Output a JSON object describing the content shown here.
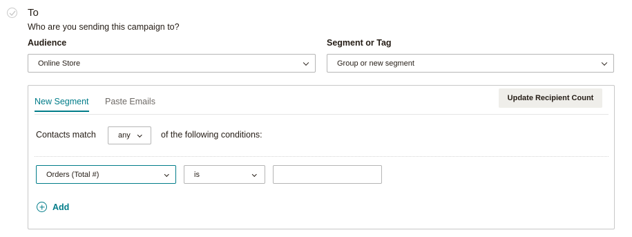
{
  "section": {
    "title": "To",
    "subtitle": "Who are you sending this campaign to?",
    "status_icon": "check-circle-icon"
  },
  "audience": {
    "label": "Audience",
    "selected": "Online Store"
  },
  "segment_or_tag": {
    "label": "Segment or Tag",
    "selected": "Group or new segment"
  },
  "panel": {
    "tabs": [
      {
        "label": "New Segment",
        "active": true
      },
      {
        "label": "Paste Emails",
        "active": false
      }
    ],
    "update_button": "Update Recipient Count",
    "match": {
      "prefix": "Contacts match",
      "selected": "any",
      "suffix": "of the following conditions:"
    },
    "condition": {
      "field": "Orders (Total #)",
      "operator": "is",
      "value": ""
    },
    "add_label": "Add"
  },
  "colors": {
    "accent": "#007c89",
    "button_bg": "#efeeea",
    "text": "#241c15"
  }
}
